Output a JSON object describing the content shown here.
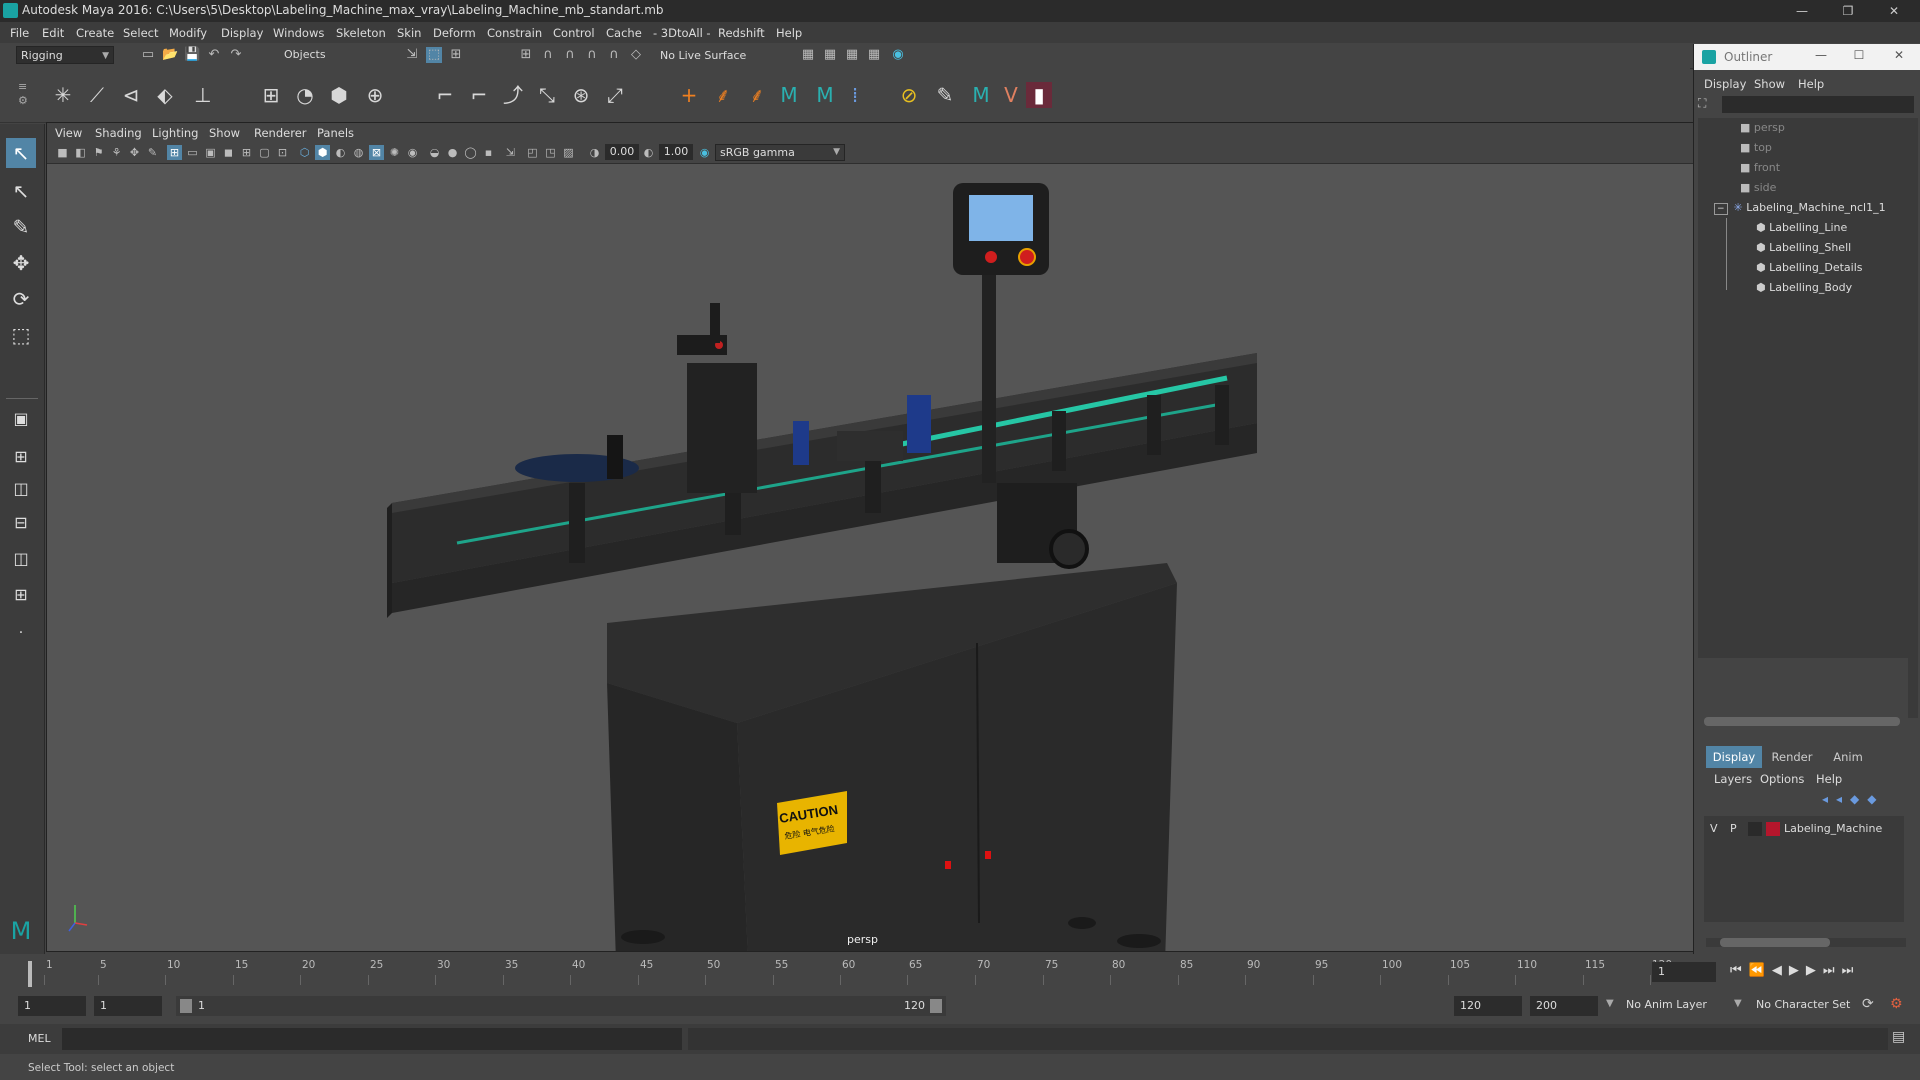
{
  "window": {
    "title": "Autodesk Maya 2016: C:\\Users\\5\\Desktop\\Labeling_Machine_max_vray\\Labeling_Machine_mb_standart.mb",
    "minimize": "—",
    "restore": "❐",
    "close": "✕"
  },
  "menubar": [
    "File",
    "Edit",
    "Create",
    "Select",
    "Modify",
    "Display",
    "Windows",
    "Skeleton",
    "Skin",
    "Deform",
    "Constrain",
    "Control",
    "Cache",
    "- 3DtoAll -",
    "Redshift",
    "Help"
  ],
  "statusline": {
    "menuset": "Rigging",
    "selection_mode": "Objects",
    "live_surface": "No Live Surface"
  },
  "viewport": {
    "menu": [
      "View",
      "Shading",
      "Lighting",
      "Show",
      "Renderer",
      "Panels"
    ],
    "exposure": "0.00",
    "gamma": "1.00",
    "color_space": "sRGB gamma",
    "camera_label": "persp",
    "caution_text": "CAUTION",
    "caution_sub": "危险 电气危险"
  },
  "outliner": {
    "title": "Outliner",
    "menu": [
      "Display",
      "Show",
      "Help"
    ],
    "items": [
      {
        "label": "persp",
        "dim": true,
        "indent": 1
      },
      {
        "label": "top",
        "dim": true,
        "indent": 1
      },
      {
        "label": "front",
        "dim": true,
        "indent": 1
      },
      {
        "label": "side",
        "dim": true,
        "indent": 1
      },
      {
        "label": "Labeling_Machine_ncl1_1",
        "dim": false,
        "indent": 0,
        "expander": "−"
      },
      {
        "label": "Labelling_Line",
        "dim": false,
        "indent": 2
      },
      {
        "label": "Labelling_Shell",
        "dim": false,
        "indent": 2
      },
      {
        "label": "Labelling_Details",
        "dim": false,
        "indent": 2
      },
      {
        "label": "Labelling_Body",
        "dim": false,
        "indent": 2
      }
    ]
  },
  "layers": {
    "tabs": [
      "Display",
      "Render",
      "Anim"
    ],
    "active_tab": "Display",
    "menu": [
      "Layers",
      "Options",
      "Help"
    ],
    "layer": {
      "v": "V",
      "p": "P",
      "name": "Labeling_Machine",
      "color": "#b5162c"
    }
  },
  "timeline": {
    "ticks": [
      1,
      5,
      10,
      15,
      20,
      25,
      30,
      35,
      40,
      45,
      50,
      55,
      60,
      65,
      70,
      75,
      80,
      85,
      90,
      95,
      100,
      105,
      110,
      115,
      120
    ],
    "current_frame": "1",
    "range_start": "1",
    "playback_start": "1",
    "slider_start": "1",
    "slider_end": "120",
    "playback_end": "120",
    "range_end": "200",
    "anim_layer": "No Anim Layer",
    "character_set": "No Character Set"
  },
  "cmdline": {
    "lang": "MEL"
  },
  "helpline": "Select Tool: select an object",
  "colors": {
    "accent": "#5285a6",
    "maya_teal": "#1aa3a3",
    "caution_yellow": "#e8b400"
  }
}
